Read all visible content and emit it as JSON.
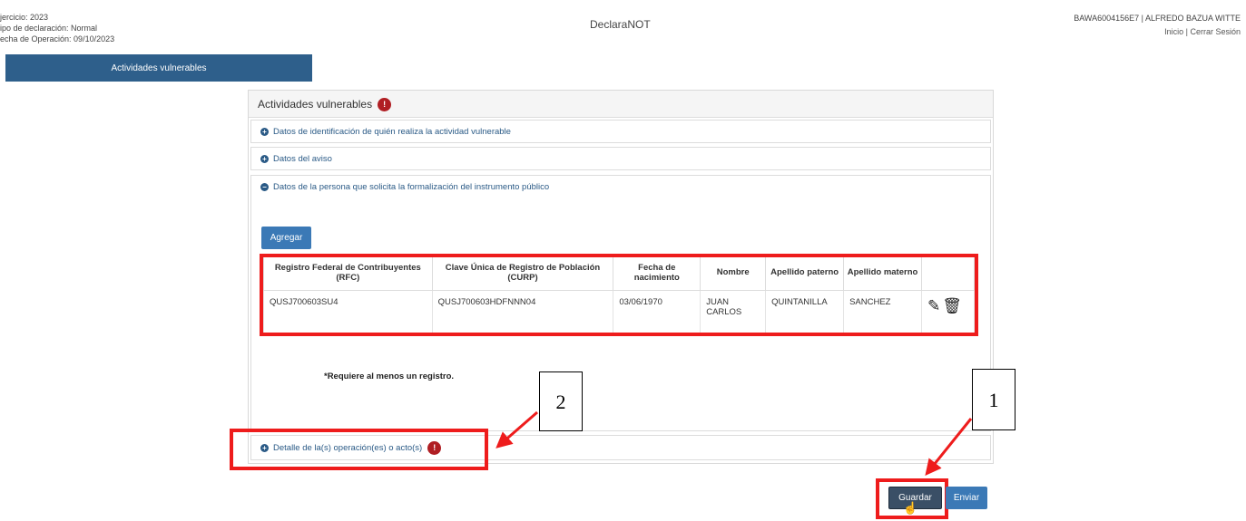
{
  "header": {
    "left_lines": [
      "jercicio: 2023",
      "ipo de declaración: Normal",
      "echa de Operación: 09/10/2023"
    ],
    "center_title": "DeclaraNOT",
    "user": "BAWA6004156E7 | ALFREDO BAZUA WITTE",
    "link_inicio": "Inicio",
    "link_sep": " | ",
    "link_cerrar": "Cerrar Sesión"
  },
  "nav": {
    "tab_label": "Actividades vulnerables"
  },
  "panel": {
    "title": "Actividades vulnerables",
    "title_badge": "!",
    "sections": [
      {
        "label": "Datos de identificación de quién realiza la actividad vulnerable",
        "icon": "plus"
      },
      {
        "label": "Datos del aviso",
        "icon": "plus"
      },
      {
        "label": "Datos de la persona que solicita la formalización del instrumento público",
        "icon": "minus"
      },
      {
        "label": "Detalle de la(s) operación(es) o acto(s)",
        "icon": "plus",
        "badge": "!"
      }
    ],
    "add_button": "Agregar",
    "table": {
      "headers": [
        "Registro Federal de Contribuyentes (RFC)",
        "Clave Única de Registro de Población (CURP)",
        "Fecha de nacimiento",
        "Nombre",
        "Apellido paterno",
        "Apellido materno",
        ""
      ],
      "rows": [
        [
          "QUSJ700603SU4",
          "QUSJ700603HDFNNN04",
          "03/06/1970",
          "JUAN CARLOS",
          "QUINTANILLA",
          "SANCHEZ"
        ]
      ]
    },
    "note": "*Requiere al menos un registro."
  },
  "icons": {
    "edit": "edit-icon",
    "delete": "trash-icon"
  },
  "actions": {
    "save": "Guardar",
    "send": "Enviar"
  },
  "annotations": {
    "callout_1": "1",
    "callout_2": "2"
  },
  "colors": {
    "accent": "#2e5f8b",
    "button": "#3b79b6",
    "highlight": "#ee1c1c",
    "badge": "#b01e23"
  }
}
